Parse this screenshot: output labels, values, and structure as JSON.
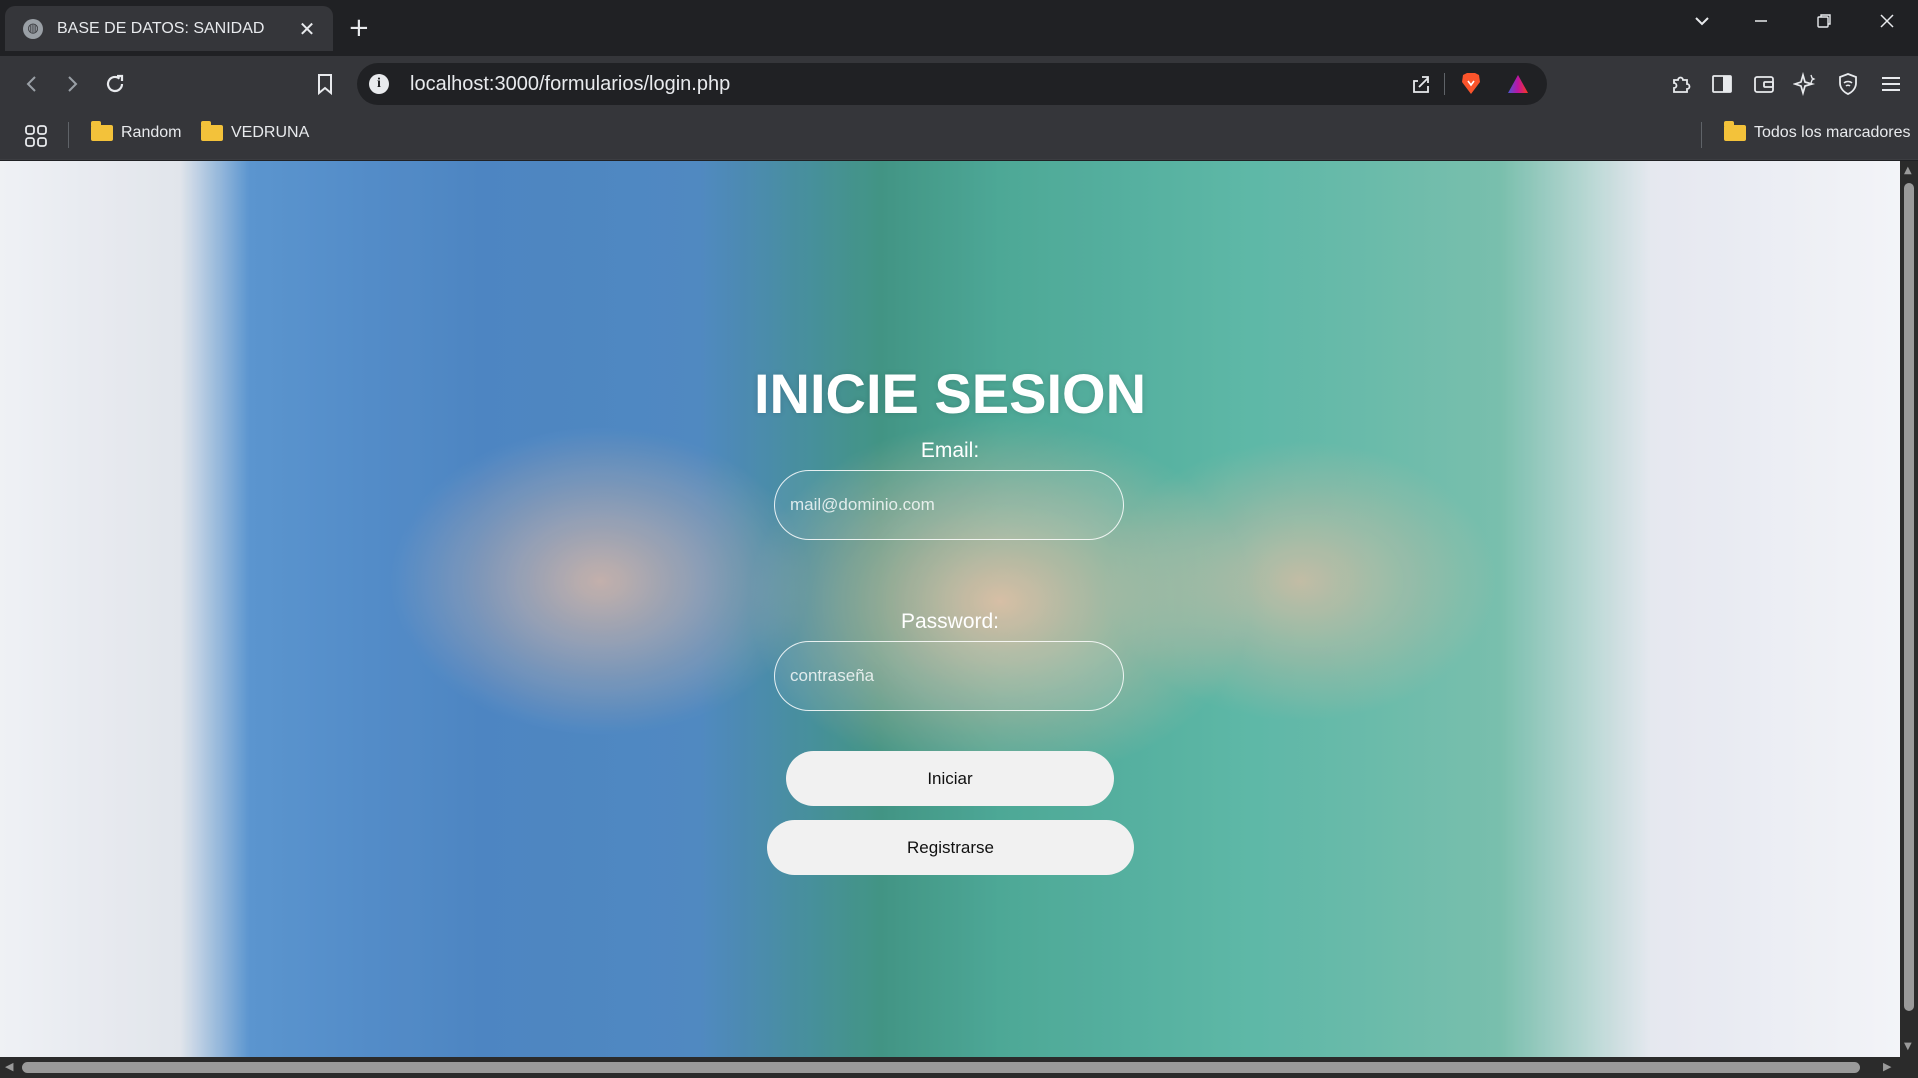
{
  "browser": {
    "tab_title": "BASE DE DATOS: SANIDAD",
    "url": "localhost:3000/formularios/login.php",
    "bookmarks": [
      {
        "label": "Random"
      },
      {
        "label": "VEDRUNA"
      }
    ],
    "all_bookmarks_label": "Todos los marcadores"
  },
  "login": {
    "title": "INICIE SESION",
    "email_label": "Email:",
    "email_placeholder": "mail@dominio.com",
    "password_label": "Password:",
    "password_placeholder": "contraseña",
    "login_button": "Iniciar",
    "register_button": "Registrarse"
  },
  "icons": {
    "tab_favicon": "globe-icon",
    "brave_icon": "brave-lion-icon",
    "rewards_icon": "brave-rewards-triangle-icon"
  },
  "colors": {
    "tab_strip": "#202124",
    "toolbar": "#35363a",
    "button_bg": "#f1f1f1"
  }
}
